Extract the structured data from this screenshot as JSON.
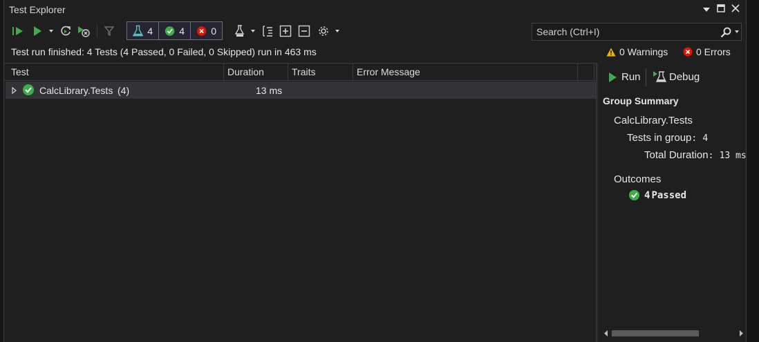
{
  "window": {
    "title": "Test Explorer"
  },
  "toolbar": {
    "counters": {
      "total": "4",
      "passed": "4",
      "failed": "0"
    }
  },
  "search": {
    "placeholder": "Search (Ctrl+I)"
  },
  "status": {
    "message": "Test run finished: 4 Tests (4 Passed, 0 Failed, 0 Skipped) run in 463 ms",
    "warnings": "0 Warnings",
    "errors": "0 Errors"
  },
  "grid": {
    "columns": [
      "Test",
      "Duration",
      "Traits",
      "Error Message"
    ],
    "rows": [
      {
        "name": "CalcLibrary.Tests",
        "count": "(4)",
        "duration": "13 ms"
      }
    ]
  },
  "summary": {
    "run_label": "Run",
    "debug_label": "Debug",
    "heading": "Group Summary",
    "group_name": "CalcLibrary.Tests",
    "tests_in_group_label": "Tests in group",
    "tests_in_group_value": "4",
    "total_duration_label": "Total Duration",
    "total_duration_value": "13 ms",
    "outcomes_label": "Outcomes",
    "passed_count": "4",
    "passed_label": "Passed"
  },
  "colors": {
    "passed": "#3fae49",
    "failed": "#e51400",
    "warning": "#f0b400",
    "accent": "#6b5bd6"
  }
}
